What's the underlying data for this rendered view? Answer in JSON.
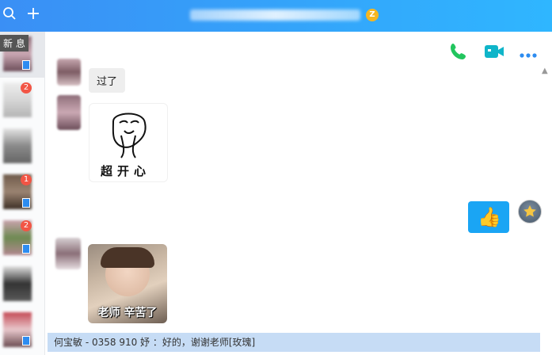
{
  "window": {
    "title": ""
  },
  "toolbar": {
    "search_icon": "search-icon",
    "add_icon": "plus-icon",
    "vip_badge": "Z"
  },
  "sidebar": {
    "tooltip": "新 息",
    "contacts": [
      {
        "unread": "",
        "device": "device-icon"
      },
      {
        "unread": "2",
        "device": ""
      },
      {
        "unread": "",
        "device": ""
      },
      {
        "unread": "1",
        "device": "device-icon"
      },
      {
        "unread": "2",
        "device": "device-icon"
      },
      {
        "unread": "",
        "device": ""
      },
      {
        "unread": "",
        "device": "device-icon"
      }
    ]
  },
  "header_actions": [
    {
      "icon": "phone-icon",
      "color": "#22c55e"
    },
    {
      "icon": "video-icon",
      "color": "#0fb5c9"
    },
    {
      "icon": "more-icon",
      "color": "#2d8cf0"
    }
  ],
  "messages": [
    {
      "side": "left",
      "type": "text",
      "text": "过了"
    },
    {
      "side": "left",
      "type": "sticker",
      "caption": "超开心"
    },
    {
      "side": "right",
      "type": "sticker",
      "emoji": "👍"
    },
    {
      "side": "left",
      "type": "photo",
      "caption": "老师 辛苦了"
    }
  ],
  "notification": {
    "text": "何宝敏 - 0358 910        妤 ：好的，谢谢老师[玫瑰]"
  },
  "colors": {
    "topbar_start": "#3a8ff5",
    "topbar_end": "#2fb6ff",
    "self_bubble": "#1aa5f4",
    "notify_bg": "#c6dcf5"
  }
}
